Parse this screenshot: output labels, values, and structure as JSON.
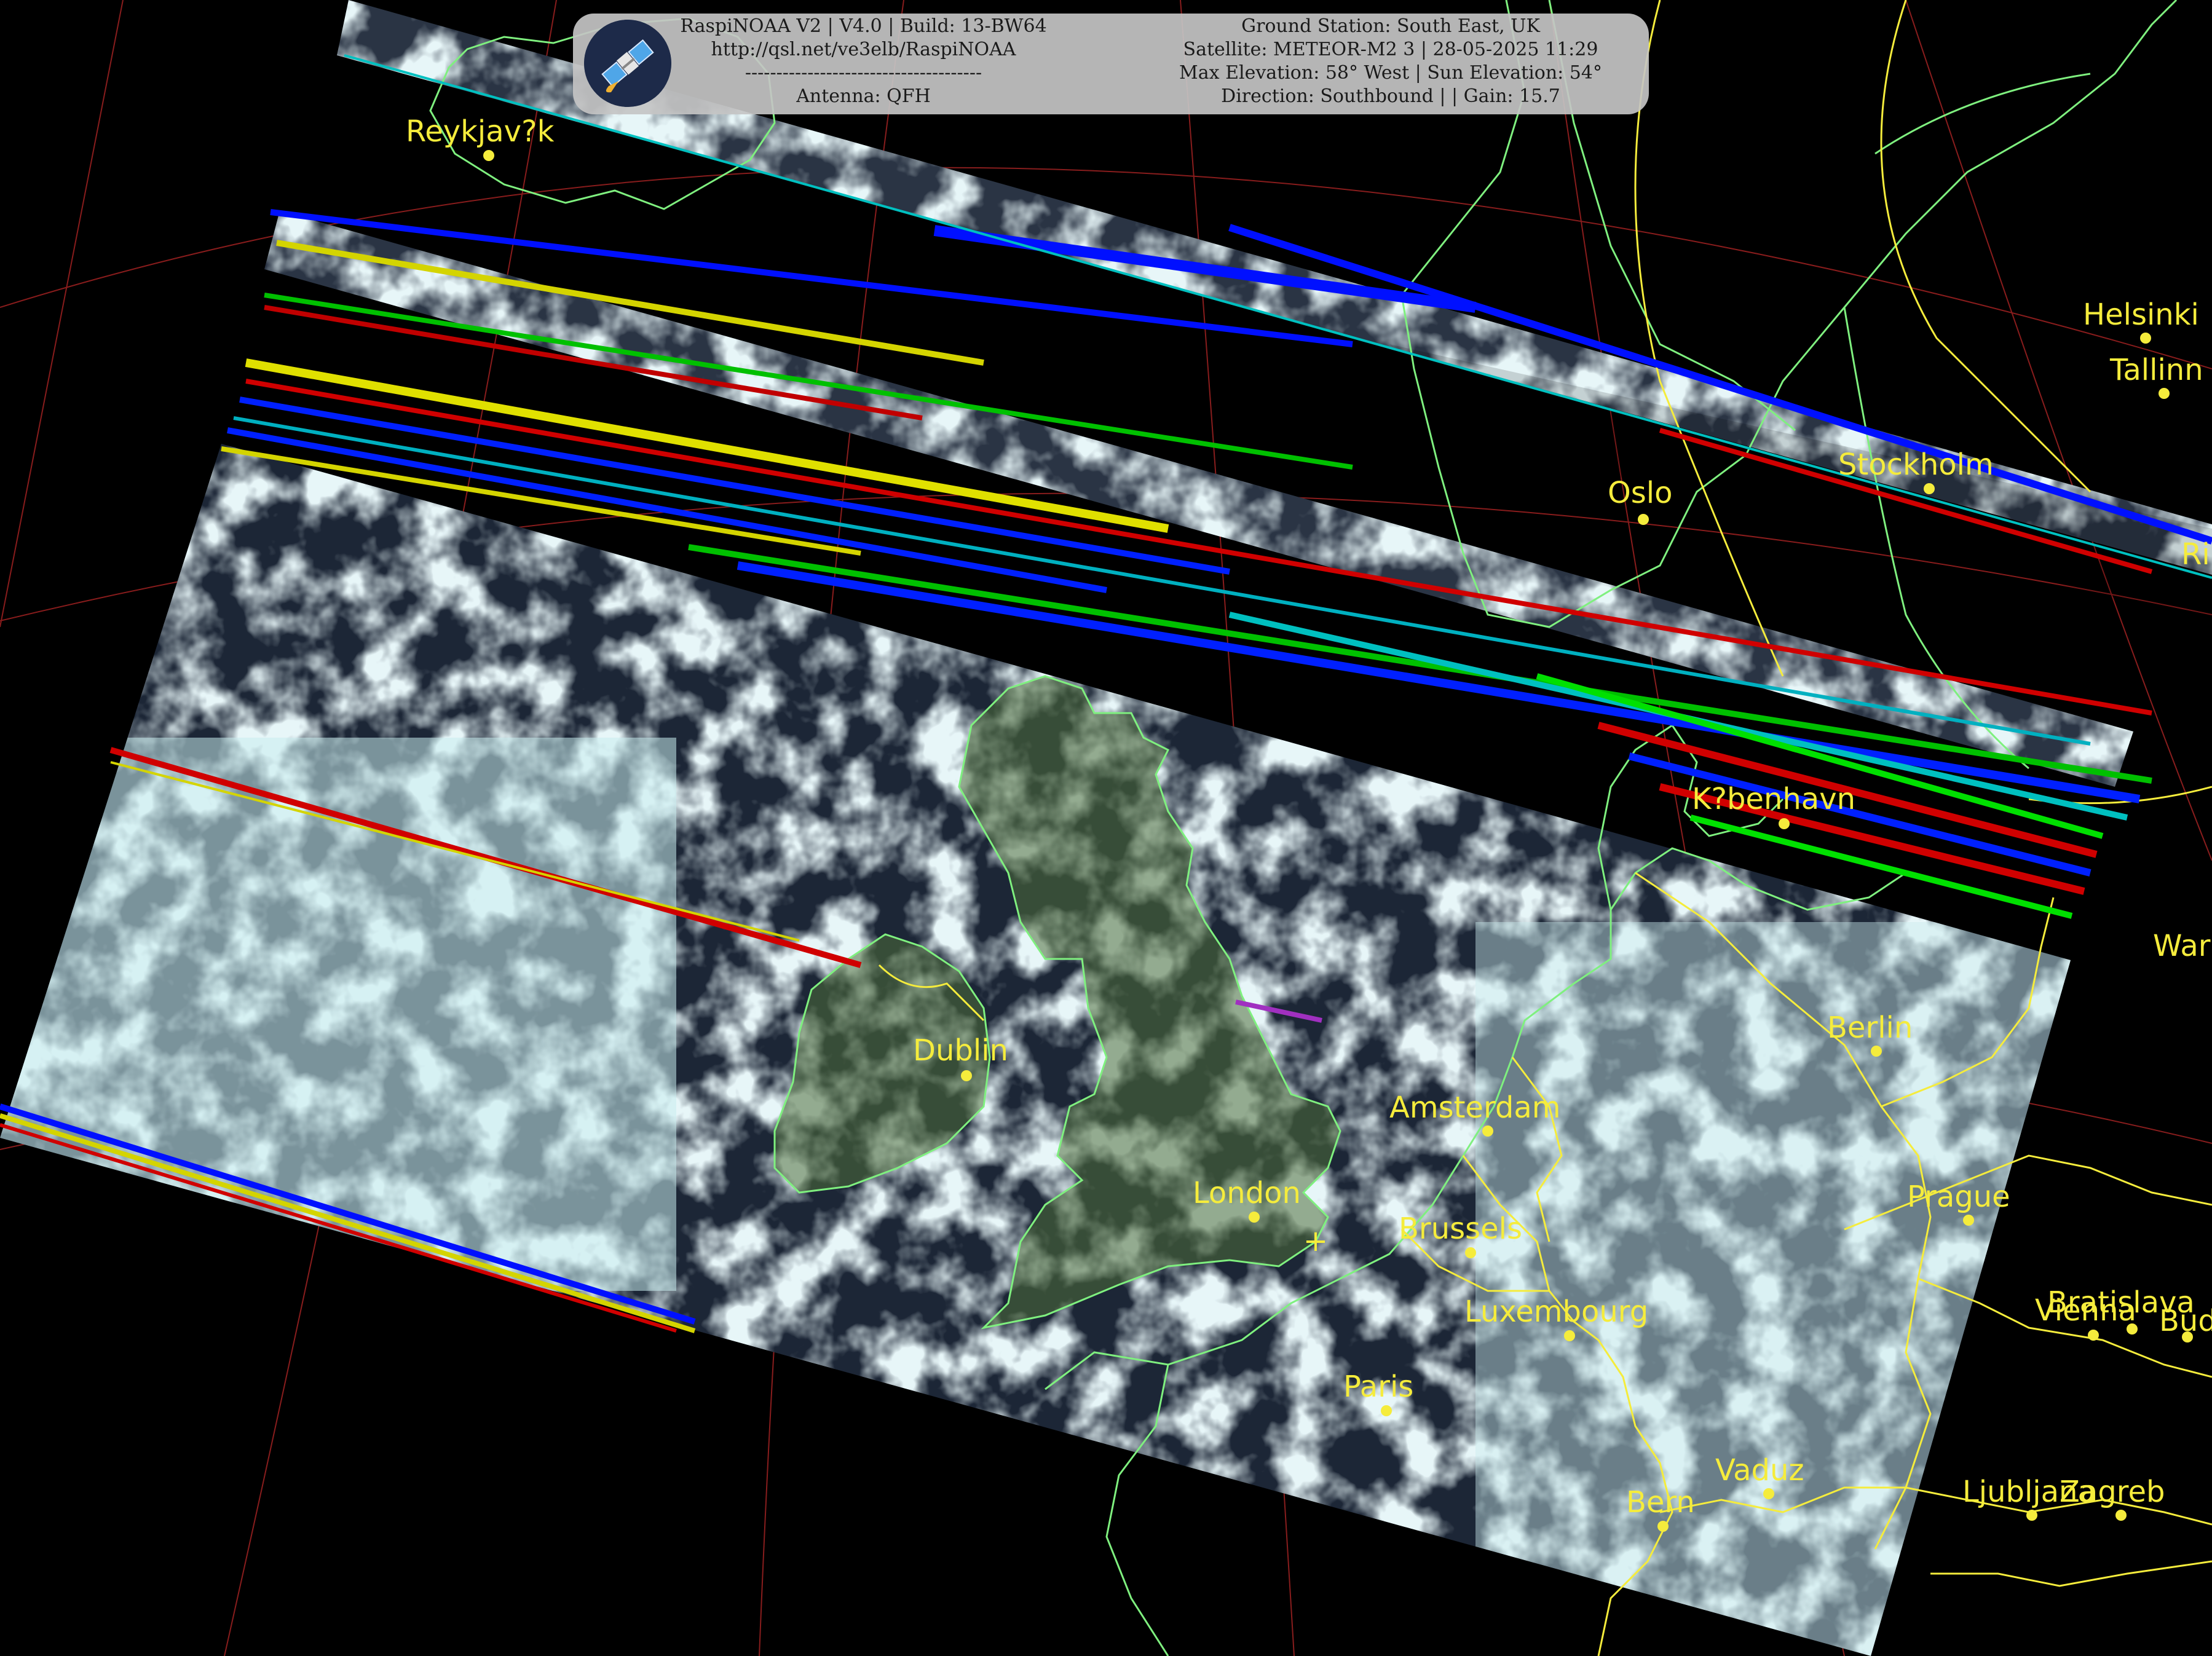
{
  "banner": {
    "left_lines": [
      "RaspiNOAA V2 | V4.0 | Build: 13-BW64",
      "http://qsl.net/ve3elb/RaspiNOAA",
      "--------------------------------------",
      "Antenna: QFH"
    ],
    "right_lines": [
      "Ground Station: South East, UK",
      "Satellite: METEOR-M2 3 | 28-05-2025 11:29",
      "Max Elevation: 58° West | Sun Elevation: 54°",
      "Direction: Southbound | | Gain: 15.7"
    ],
    "logo_icon": "satellite-icon"
  },
  "cities": [
    {
      "name": "Reykjav?k"
    },
    {
      "name": "Helsinki"
    },
    {
      "name": "Tallinn"
    },
    {
      "name": "Stockholm"
    },
    {
      "name": "Oslo"
    },
    {
      "name": "Ri"
    },
    {
      "name": "K?benhavn"
    },
    {
      "name": "Wars"
    },
    {
      "name": "Berlin"
    },
    {
      "name": "Dublin"
    },
    {
      "name": "Amsterdam"
    },
    {
      "name": "London"
    },
    {
      "name": "Prague"
    },
    {
      "name": "Brussels"
    },
    {
      "name": "Bratislava"
    },
    {
      "name": "Vienna"
    },
    {
      "name": "Bud"
    },
    {
      "name": "Luxembourg"
    },
    {
      "name": "Paris"
    },
    {
      "name": "Vaduz"
    },
    {
      "name": "Bern"
    },
    {
      "name": "Ljubljana"
    },
    {
      "name": "Zagreb"
    }
  ],
  "colors": {
    "label": "#f5ec3c",
    "coast": "#7ff07f",
    "border": "#f5ec3c",
    "grid": "#b02020",
    "sea": "#1c2636",
    "cloud": "#c9ecee",
    "land": "#4f6d3a",
    "station_marker": "#f5ec3c"
  },
  "station_marker": "+"
}
